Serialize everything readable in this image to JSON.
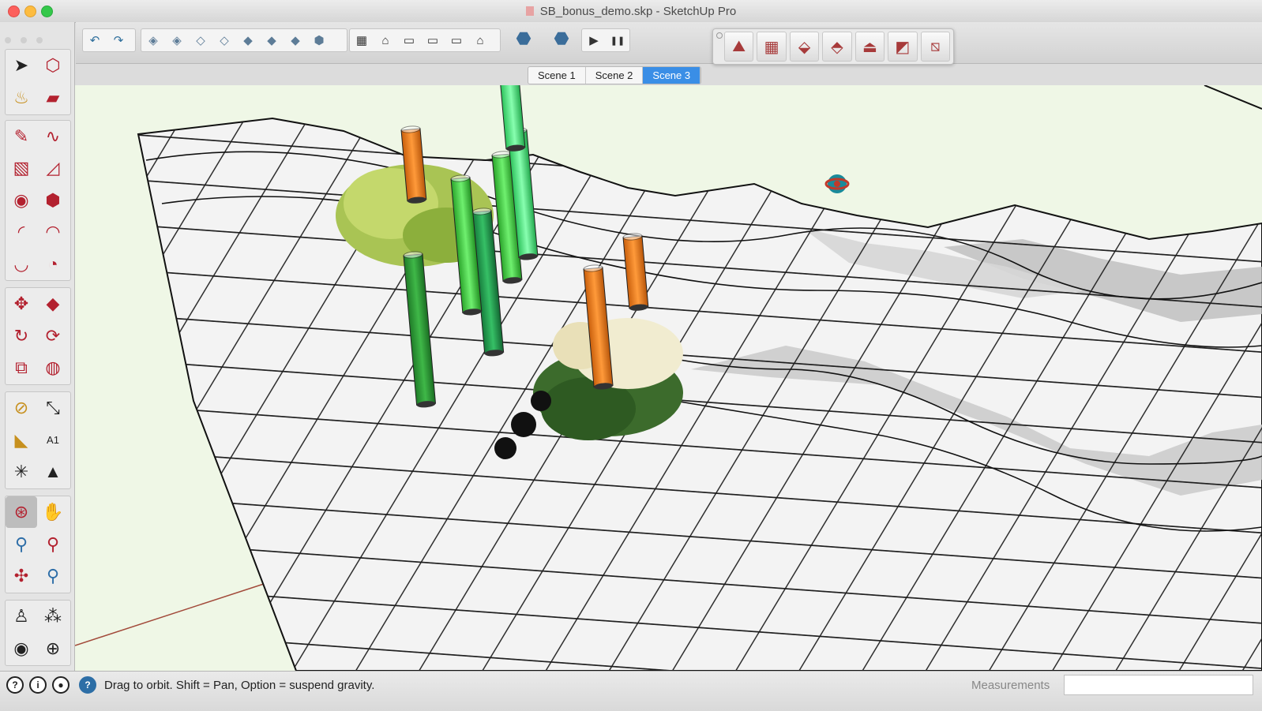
{
  "window": {
    "title": "SB_bonus_demo.skp - SketchUp Pro"
  },
  "toolbar": {
    "undo_icon": "undo-icon",
    "redo_icon": "redo-icon",
    "play_label": "▶",
    "pause_label": "❚❚"
  },
  "scenes": [
    {
      "label": "Scene 1",
      "active": false
    },
    {
      "label": "Scene 2",
      "active": false
    },
    {
      "label": "Scene 3",
      "active": true
    }
  ],
  "sandbox_tools": [
    "from-contours-icon",
    "from-scratch-icon",
    "smoove-icon",
    "stamp-icon",
    "drape-icon",
    "add-detail-icon",
    "flip-edge-icon"
  ],
  "flatten_tools": [
    "flatten-icon",
    "drop-icon",
    "drop-multiple-icon",
    "grow-icon",
    "lift-icon"
  ],
  "status": {
    "message": "Drag to orbit. Shift = Pan, Option = suspend gravity.",
    "measurements_label": "Measurements",
    "measurements_value": ""
  },
  "colors": {
    "accent": "#3a8ee6",
    "sky": "#eff7e6",
    "terrain": "#ffffff",
    "orange_post": "#f07f1a",
    "green_post": "#2ea33a"
  }
}
